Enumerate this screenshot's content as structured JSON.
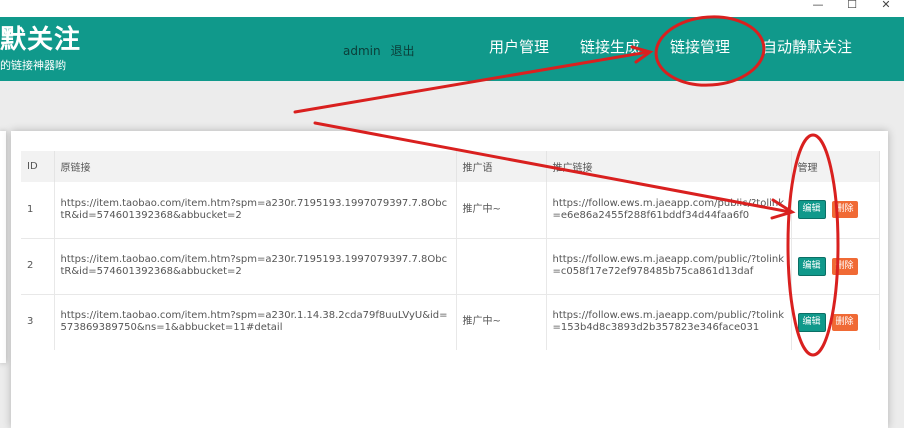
{
  "window": {
    "min": "—",
    "max": "☐",
    "close": "✕"
  },
  "header": {
    "logo_title": "默关注",
    "logo_sub": "的链接神器哟",
    "user": "admin",
    "logout": "退出",
    "nav": [
      "用户管理",
      "链接生成",
      "链接管理",
      "自动静默关注"
    ]
  },
  "table": {
    "columns": [
      "ID",
      "原链接",
      "推广语",
      "推广链接",
      "管理"
    ],
    "rows": [
      {
        "id": "1",
        "orig": "https://item.taobao.com/item.htm?spm=a230r.7195193.1997079397.7.8ObctR&id=574601392368&abbucket=2",
        "slogan": "推广中~",
        "promo": "https://follow.ews.m.jaeapp.com/public/?tolink=e6e86a2455f288f61bddf34d44faa6f0"
      },
      {
        "id": "2",
        "orig": "https://item.taobao.com/item.htm?spm=a230r.7195193.1997079397.7.8ObctR&id=574601392368&abbucket=2",
        "slogan": "",
        "promo": "https://follow.ews.m.jaeapp.com/public/?tolink=c058f17e72ef978485b75ca861d13daf"
      },
      {
        "id": "3",
        "orig": "https://item.taobao.com/item.htm?spm=a230r.1.14.38.2cda79f8uuLVyU&id=573869389750&ns=1&abbucket=11#detail",
        "slogan": "推广中~",
        "promo": "https://follow.ews.m.jaeapp.com/public/?tolink=153b4d8c3893d2b357823e346face031"
      }
    ],
    "edit_label": "编辑",
    "delete_label": "删除"
  },
  "colors": {
    "header_bg": "#10998b",
    "edit_bg": "#10998b",
    "delete_bg": "#f06a35",
    "annotation": "#d9201f"
  }
}
